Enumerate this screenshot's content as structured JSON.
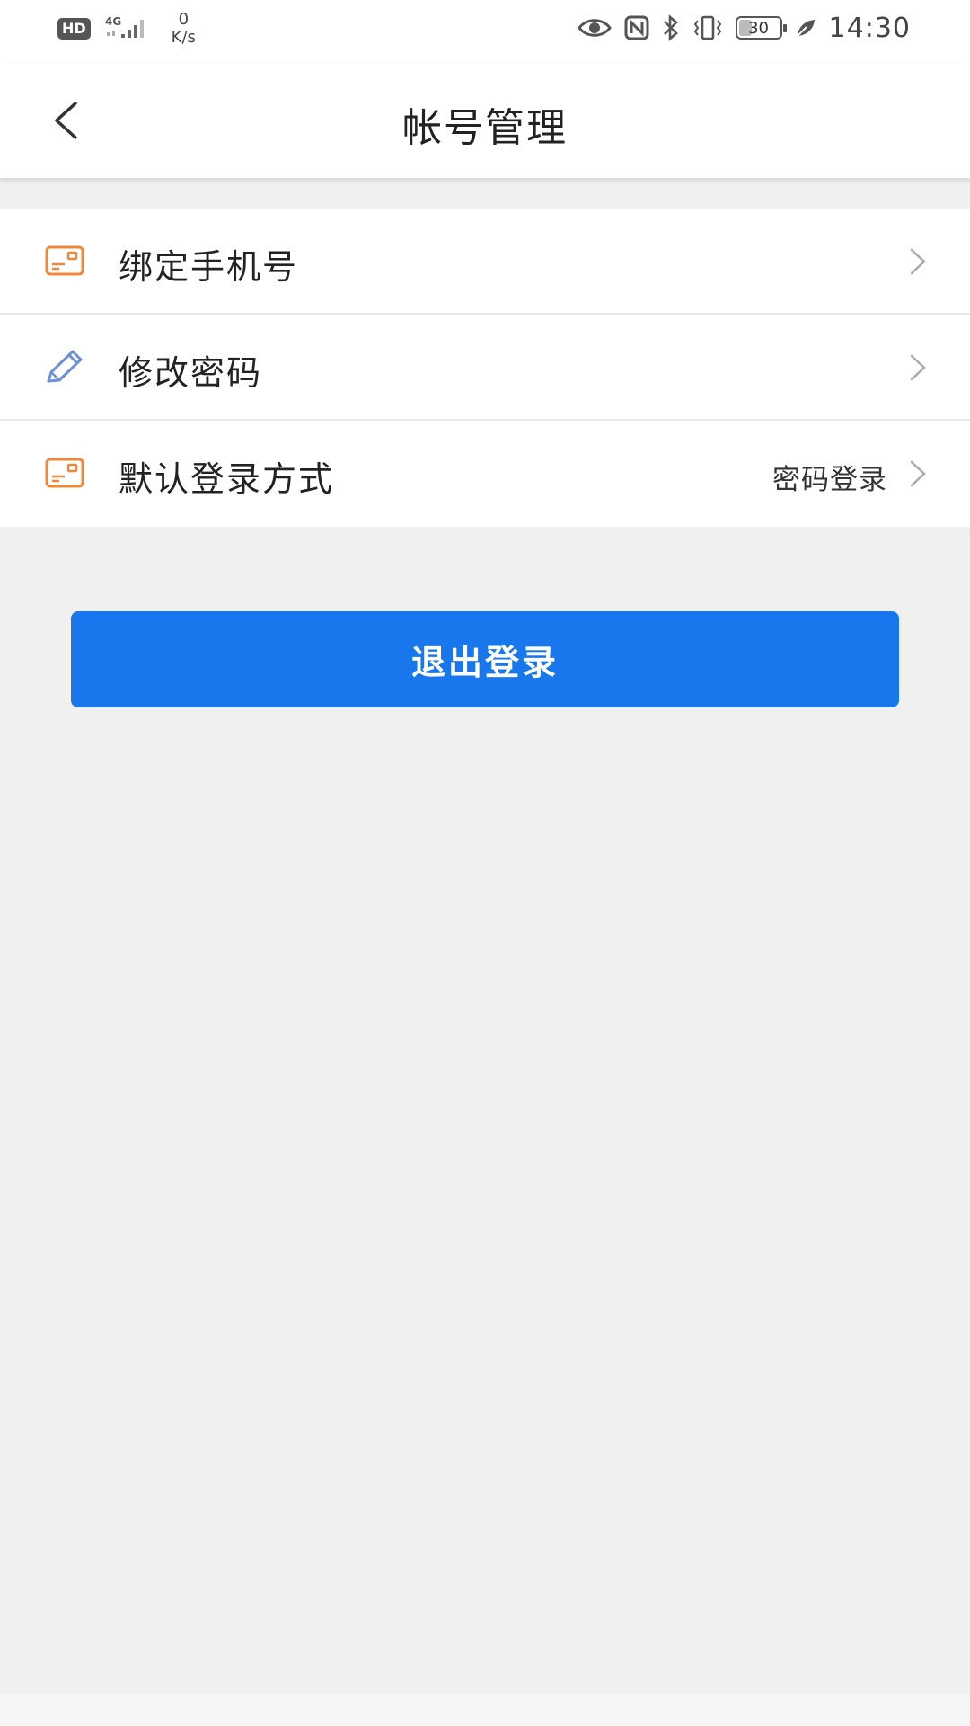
{
  "status_bar": {
    "hd_label": "HD",
    "network_label": "4G",
    "net_speed_value": "0",
    "net_speed_unit": "K/s",
    "battery_level": "30",
    "time": "14:30",
    "icons": [
      "eye-icon",
      "nfc-icon",
      "bluetooth-icon",
      "vibrate-icon",
      "battery-icon",
      "leaf-icon"
    ]
  },
  "header": {
    "back_icon": "chevron-left-icon",
    "title": "帐号管理"
  },
  "menu": {
    "items": [
      {
        "label": "绑定手机号",
        "value": "",
        "icon": "card-icon"
      },
      {
        "label": "修改密码",
        "value": "",
        "icon": "pencil-icon"
      },
      {
        "label": "默认登录方式",
        "value": "密码登录",
        "icon": "card-icon"
      }
    ]
  },
  "actions": {
    "logout_label": "退出登录"
  },
  "colors": {
    "accent_blue": "#1877ec",
    "icon_orange": "#f0883a",
    "icon_blue": "#6f8fd6",
    "background": "#f0f0f0"
  }
}
